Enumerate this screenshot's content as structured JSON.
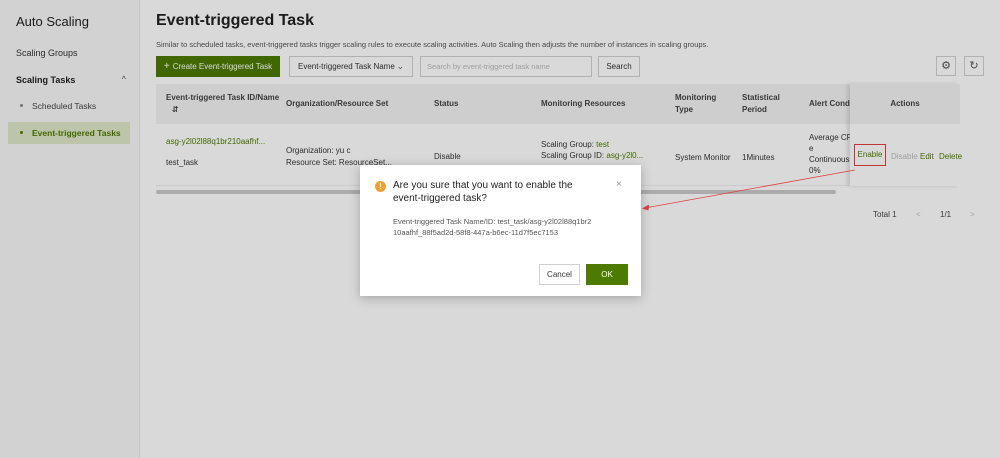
{
  "sidebar": {
    "title": "Auto Scaling",
    "items": [
      {
        "label": "Scaling Groups"
      },
      {
        "label": "Scaling Tasks",
        "chevron": "^"
      }
    ],
    "subitems": [
      {
        "label": "Scheduled Tasks"
      },
      {
        "label": "Event-triggered Tasks"
      }
    ]
  },
  "header": {
    "title": "Event-triggered Task",
    "description": "Similar to scheduled tasks, event-triggered tasks trigger scaling rules to execute scaling activities. Auto Scaling then adjusts the number of instances in scaling groups."
  },
  "toolbar": {
    "create_label": "Create Event-triggered Task",
    "create_icon": "+",
    "filter_select": "Event-triggered Task Name",
    "search_placeholder": "Search by event-triggered task name",
    "search_label": "Search",
    "settings_icon": "⚙",
    "refresh_icon": "↻"
  },
  "table": {
    "columns": {
      "id_name": "Event-triggered Task ID/Name",
      "sort_icon": "⇵",
      "org": "Organization/Resource Set",
      "status": "Status",
      "monitoring": "Monitoring Resources",
      "monitoring_type": "Monitoring Type",
      "period": "Statistical Period",
      "alert": "Alert Condi",
      "actions": "Actions"
    },
    "rows": [
      {
        "id": "asg-y2l02l88q1br210aafhf...",
        "name": "test_task",
        "org": "Organization: yu c",
        "resource_set": "Resource Set: ResourceSet...",
        "status": "Disable",
        "group_label": "Scaling Group:",
        "group_value": "test",
        "group_id_label": "Scaling Group ID:",
        "group_id_value": "asg-y2l0...",
        "monitoring_type": "System Monitor",
        "period": "1Minutes",
        "alert_line1": "Average CP",
        "alert_line2": "e",
        "alert_line3": "Continuous",
        "alert_line4": "0%",
        "actions": {
          "enable": "Enable",
          "disable": "Disable",
          "edit": "Edit",
          "delete": "Delete"
        }
      }
    ]
  },
  "pagination": {
    "total": "Total 1",
    "page": "1/1",
    "prev": "<",
    "next": ">"
  },
  "dialog": {
    "icon": "!",
    "title": "Are you sure that you want to enable the event-triggered task?",
    "close": "×",
    "body": "Event-triggered Task Name/ID: test_task/asg-y2l02l88q1br210aafhf_88f5ad2d-58f8-447a-b6ec-11d7f5ec7153",
    "cancel": "Cancel",
    "ok": "OK"
  }
}
